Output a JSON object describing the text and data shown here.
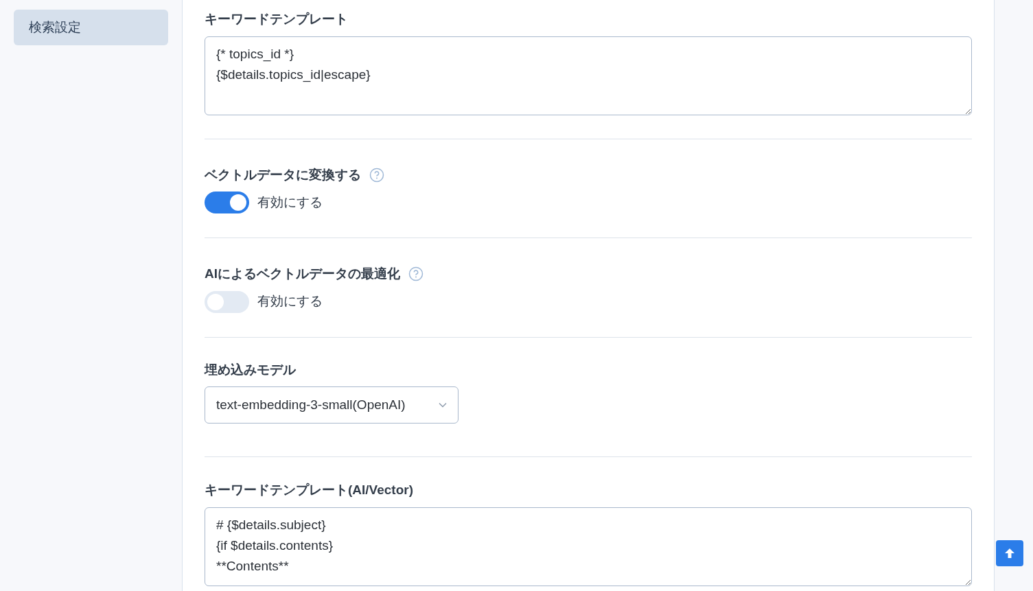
{
  "sidebar": {
    "items": [
      {
        "label": "検索設定",
        "selected": true
      }
    ]
  },
  "sections": [
    {
      "kind": "textarea",
      "label": "キーワードテンプレート",
      "value": "{* topics_id *}\n{$details.topics_id|escape}\n"
    },
    {
      "kind": "toggle",
      "label": "ベクトルデータに変換する",
      "help": true,
      "toggle_label": "有効にする",
      "on": true
    },
    {
      "kind": "toggle",
      "label": "AIによるベクトルデータの最適化",
      "help": true,
      "toggle_label": "有効にする",
      "on": false
    },
    {
      "kind": "select",
      "label": "埋め込みモデル",
      "value": "text-embedding-3-small(OpenAI)"
    },
    {
      "kind": "textarea",
      "label": "キーワードテンプレート(AI/Vector)",
      "value": "# {$details.subject}\n{if $details.contents}\n**Contents**"
    }
  ]
}
